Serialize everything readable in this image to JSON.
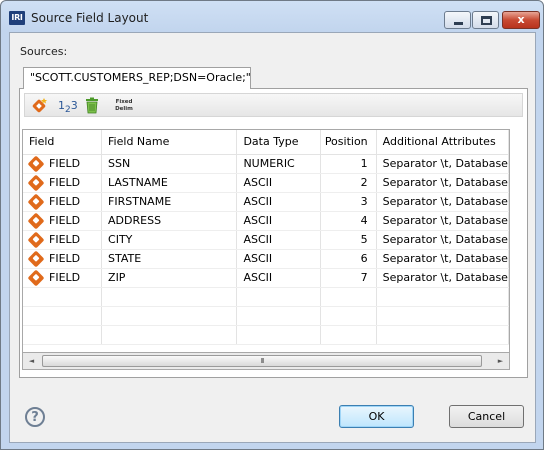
{
  "window": {
    "title": "Source Field Layout",
    "app_badge": "IRI"
  },
  "controls": {
    "close_glyph": "x"
  },
  "sources_label": "Sources:",
  "tab": {
    "label": "\"SCOTT.CUSTOMERS_REP;DSN=Oracle;\""
  },
  "toolbar": {
    "num_main": "1",
    "num_sub": "2",
    "num_tail": "3",
    "fixed_line1": "Fixed",
    "fixed_line2": "Delim"
  },
  "table": {
    "headers": [
      "Field",
      "Field Name",
      "Data Type",
      "Position",
      "Additional Attributes"
    ],
    "rows": [
      {
        "field": "FIELD",
        "name": "SSN",
        "type": "NUMERIC",
        "position": "1",
        "attrs": "Separator \\t, Database"
      },
      {
        "field": "FIELD",
        "name": "LASTNAME",
        "type": "ASCII",
        "position": "2",
        "attrs": "Separator \\t, Database"
      },
      {
        "field": "FIELD",
        "name": "FIRSTNAME",
        "type": "ASCII",
        "position": "3",
        "attrs": "Separator \\t, Database"
      },
      {
        "field": "FIELD",
        "name": "ADDRESS",
        "type": "ASCII",
        "position": "4",
        "attrs": "Separator \\t, Database"
      },
      {
        "field": "FIELD",
        "name": "CITY",
        "type": "ASCII",
        "position": "5",
        "attrs": "Separator \\t, Database"
      },
      {
        "field": "FIELD",
        "name": "STATE",
        "type": "ASCII",
        "position": "6",
        "attrs": "Separator \\t, Database"
      },
      {
        "field": "FIELD",
        "name": "ZIP",
        "type": "ASCII",
        "position": "7",
        "attrs": "Separator \\t, Database"
      }
    ]
  },
  "scrollbar": {
    "left_arrow": "◄",
    "right_arrow": "►",
    "grip": "III"
  },
  "help": {
    "glyph": "?"
  },
  "buttons": {
    "ok": "OK",
    "cancel": "Cancel"
  },
  "colors": {
    "field_icon": "#e06a1b",
    "window_frame": "#c2d5ee",
    "ok_highlight": "#bee6fd"
  }
}
